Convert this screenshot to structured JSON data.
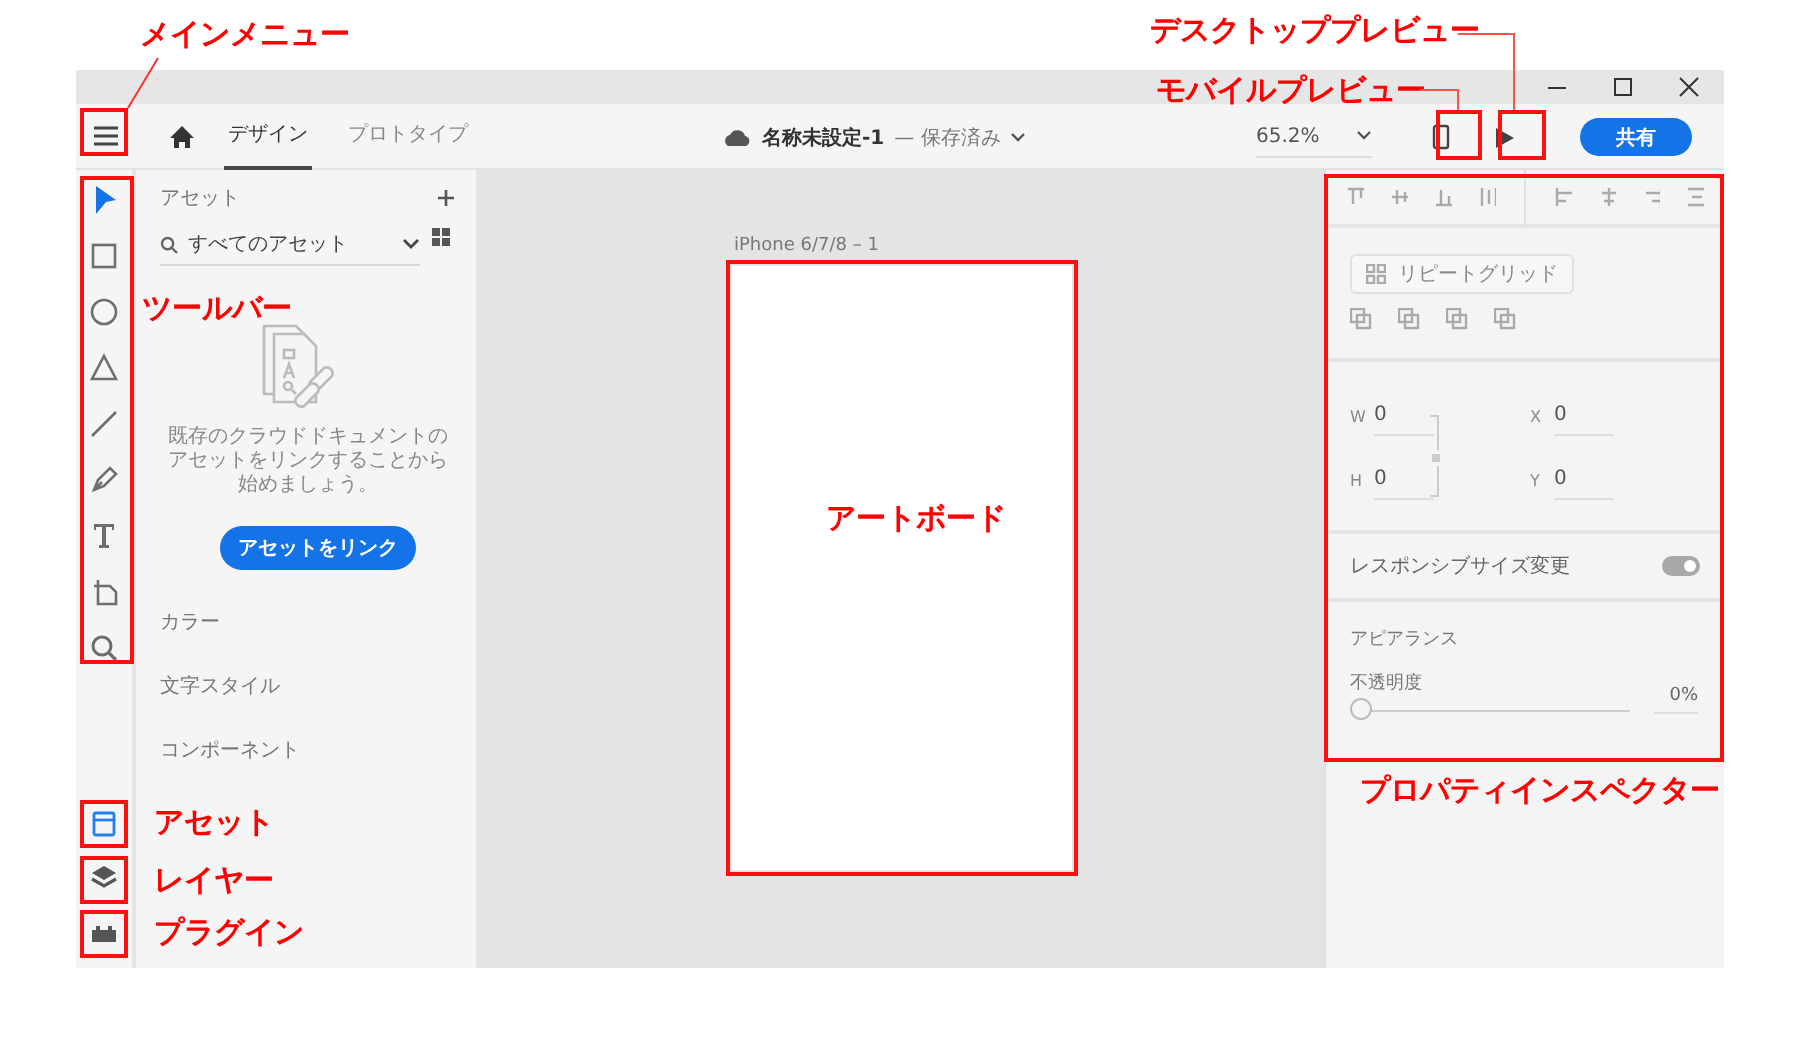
{
  "tabs": [
    {
      "label": "デザイン",
      "selected": true
    },
    {
      "label": "プロトタイプ",
      "selected": false
    }
  ],
  "document": {
    "title": "名称未設定-1",
    "status": "— 保存済み"
  },
  "zoom": "65.2%",
  "share_button": "共有",
  "tools": [
    {
      "kind": "select",
      "selected": true
    },
    {
      "kind": "rectangle",
      "selected": false
    },
    {
      "kind": "ellipse",
      "selected": false
    },
    {
      "kind": "polygon",
      "selected": false
    },
    {
      "kind": "line",
      "selected": false
    },
    {
      "kind": "pen",
      "selected": false
    },
    {
      "kind": "text",
      "selected": false
    },
    {
      "kind": "artboard",
      "selected": false
    },
    {
      "kind": "zoom",
      "selected": false
    }
  ],
  "panels": [
    {
      "kind": "assets",
      "selected": true
    },
    {
      "kind": "layers",
      "selected": false
    },
    {
      "kind": "plugins",
      "selected": false
    }
  ],
  "assets_panel": {
    "title": "アセット",
    "filter": "すべてのアセット",
    "empty_message": "既存のクラウドドキュメントのアセットをリンクすることから始めましょう。",
    "link_button": "アセットをリンク",
    "sections": [
      "カラー",
      "文字スタイル",
      "コンポーネント"
    ]
  },
  "canvas": {
    "artboard_name": "iPhone 6/7/8 – 1"
  },
  "inspector": {
    "repeat_grid_button": "リピートグリッド",
    "fields": [
      {
        "label": "W",
        "value": "0"
      },
      {
        "label": "X",
        "value": "0"
      },
      {
        "label": "H",
        "value": "0"
      },
      {
        "label": "Y",
        "value": "0"
      }
    ],
    "responsive_resize": {
      "label": "レスポンシブサイズ変更",
      "on": true
    },
    "appearance": {
      "title": "アピアランス",
      "opacity_label": "不透明度",
      "level": 0,
      "reading": "0%"
    }
  },
  "callouts": [
    {
      "text": "メインメニュー"
    },
    {
      "text": "デスクトッププレビュー"
    },
    {
      "text": "モバイルプレビュー"
    },
    {
      "text": "ツールバー"
    },
    {
      "text": "アセット"
    },
    {
      "text": "レイヤー"
    },
    {
      "text": "プラグイン"
    },
    {
      "text": "アートボード"
    },
    {
      "text": "プロパティインスペクター"
    }
  ]
}
